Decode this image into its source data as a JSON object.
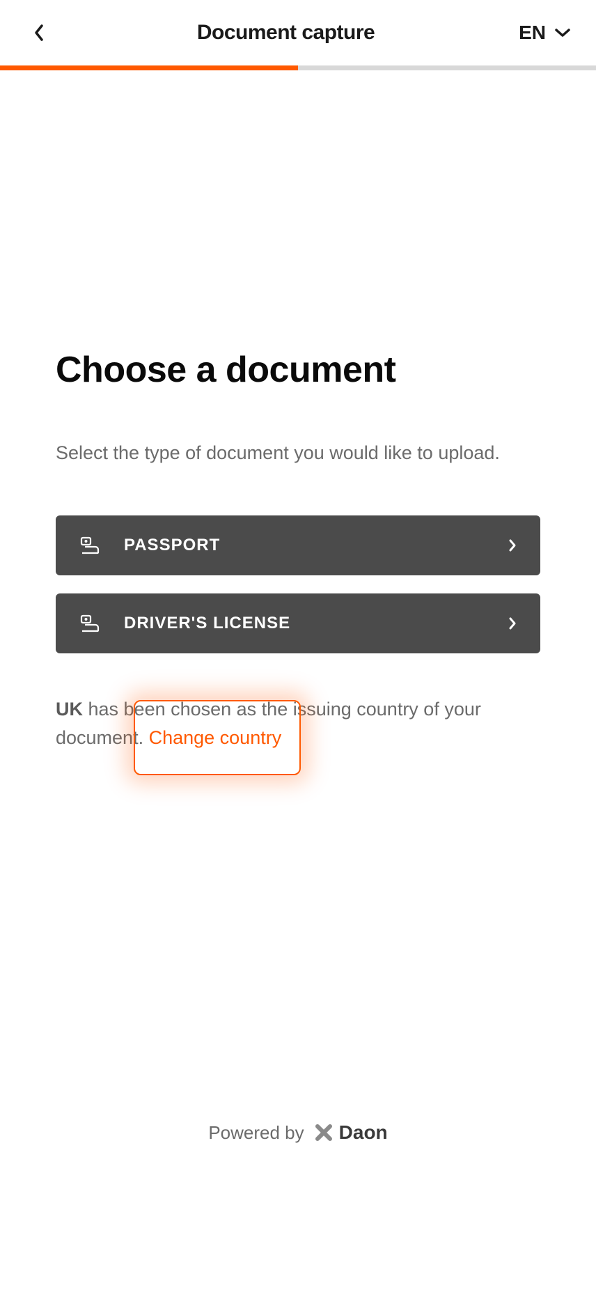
{
  "header": {
    "title": "Document capture",
    "lang": "EN"
  },
  "progress": {
    "percent": 50
  },
  "page": {
    "title": "Choose a document",
    "subtitle": "Select the type of document you would like to upload."
  },
  "documents": [
    {
      "label": "PASSPORT"
    },
    {
      "label": "DRIVER'S LICENSE"
    }
  ],
  "countryInfo": {
    "country": "UK",
    "text1": " has been chosen as the issuing country of your document. ",
    "changeLabel": "Change country"
  },
  "footer": {
    "poweredBy": "Powered by",
    "brand": "Daon"
  }
}
